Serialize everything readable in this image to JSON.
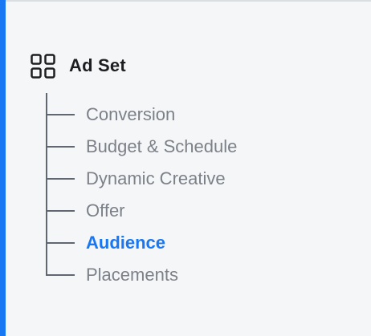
{
  "colors": {
    "accent": "#1877f2",
    "active_text": "#1877f2",
    "inactive_text": "#7c8088",
    "header_text": "#1c1e21",
    "tree_line": "#606770"
  },
  "section": {
    "icon": "grid-icon",
    "title": "Ad Set"
  },
  "nav": {
    "items": [
      {
        "label": "Conversion",
        "active": false
      },
      {
        "label": "Budget & Schedule",
        "active": false
      },
      {
        "label": "Dynamic Creative",
        "active": false
      },
      {
        "label": "Offer",
        "active": false
      },
      {
        "label": "Audience",
        "active": true
      },
      {
        "label": "Placements",
        "active": false
      }
    ]
  }
}
